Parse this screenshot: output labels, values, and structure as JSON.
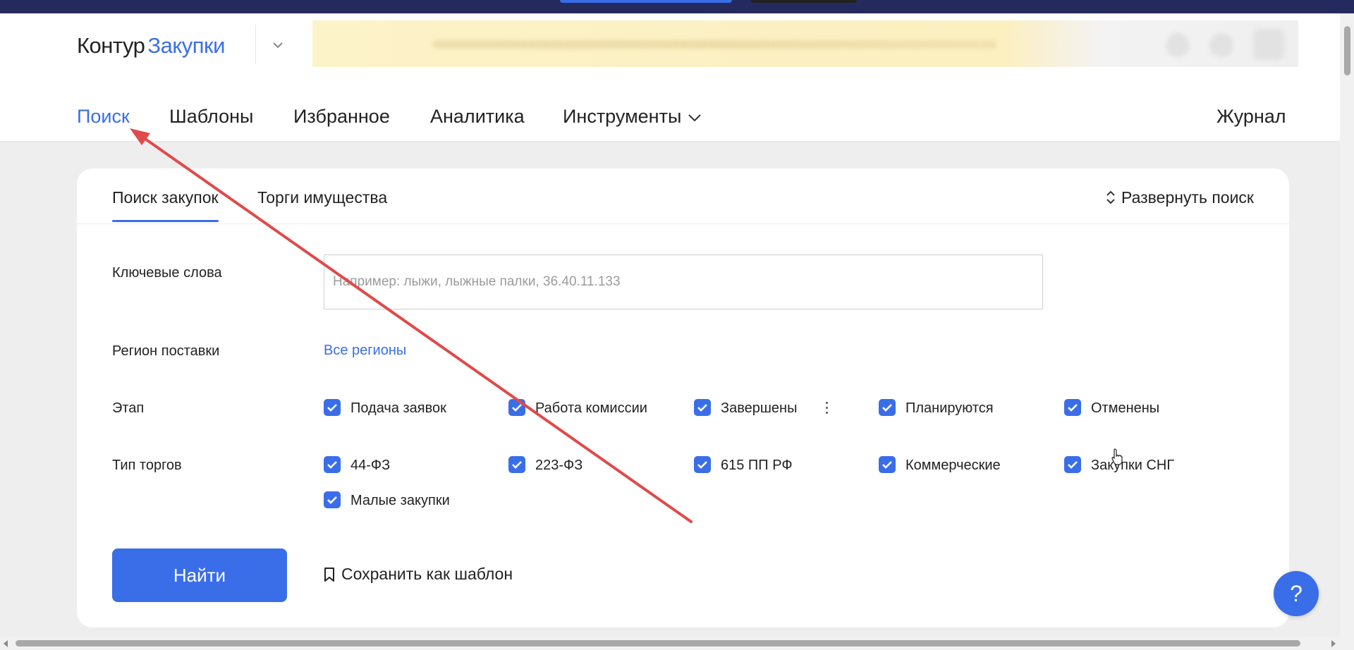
{
  "header": {
    "brand": "Контур",
    "product": "Закупки"
  },
  "nav": {
    "items": [
      {
        "label": "Поиск",
        "active": true
      },
      {
        "label": "Шаблоны"
      },
      {
        "label": "Избранное"
      },
      {
        "label": "Аналитика"
      },
      {
        "label": "Инструменты",
        "dropdown": true
      }
    ],
    "journal": "Журнал"
  },
  "search": {
    "tabs": [
      {
        "label": "Поиск закупок",
        "active": true
      },
      {
        "label": "Торги имущества"
      }
    ],
    "expand_label": "Развернуть поиск",
    "keywords": {
      "label": "Ключевые слова",
      "value": "",
      "placeholder": "Например: лыжи, лыжные палки, 36.40.11.133"
    },
    "region": {
      "label": "Регион поставки",
      "value": "Все регионы"
    },
    "stage": {
      "label": "Этап",
      "options": [
        {
          "label": "Подача заявок",
          "checked": true
        },
        {
          "label": "Работа комиссии",
          "checked": true
        },
        {
          "label": "Завершены",
          "checked": true
        },
        {
          "label": "Планируются",
          "checked": true
        },
        {
          "label": "Отменены",
          "checked": true
        }
      ]
    },
    "trade_type": {
      "label": "Тип торгов",
      "options": [
        {
          "label": "44-ФЗ",
          "checked": true
        },
        {
          "label": "223-ФЗ",
          "checked": true
        },
        {
          "label": "615 ПП РФ",
          "checked": true
        },
        {
          "label": "Коммерческие",
          "checked": true
        },
        {
          "label": "Закупки СНГ",
          "checked": true
        },
        {
          "label": "Малые закупки",
          "checked": true
        }
      ]
    },
    "find_label": "Найти",
    "save_template_label": "Сохранить как шаблон"
  },
  "help": {
    "label": "?"
  },
  "colors": {
    "accent": "#3a6ee8",
    "topbar": "#252a5e",
    "annotation_arrow": "#e04a4a"
  },
  "icons": [
    "chevron-down-icon",
    "sort-updown-icon",
    "checkbox-checked-icon",
    "kebab-menu-icon",
    "bookmark-icon",
    "mouse-cursor-icon"
  ]
}
